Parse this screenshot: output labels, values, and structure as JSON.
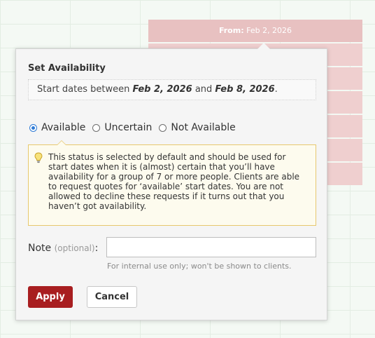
{
  "background": {
    "header_label": "From:",
    "header_date": "Feb 2, 2026"
  },
  "dialog": {
    "title": "Set Availability",
    "range_prefix": "Start dates between ",
    "range_start": "Feb 2, 2026",
    "range_conj": " and ",
    "range_end": "Feb 8, 2026",
    "range_suffix": ".",
    "options": [
      {
        "label": "Available",
        "checked": true
      },
      {
        "label": "Uncertain",
        "checked": false
      },
      {
        "label": "Not Available",
        "checked": false
      }
    ],
    "info_text": "This status is selected by default and should be used for start dates when it is (almost) certain that you’ll have availability for a group of 7 or more people. Clients are able to request quotes for ‘available’ start dates. You are not allowed to decline these requests if it turns out that you haven’t got availability.",
    "note_label": "Note",
    "note_optional": "(optional)",
    "note_colon": ":",
    "note_value": "",
    "note_help": "For internal use only; won't be shown to clients.",
    "apply_label": "Apply",
    "cancel_label": "Cancel"
  },
  "colors": {
    "accent_red": "#a81e20",
    "radio_blue": "#2f7bd6",
    "info_border": "#e7c86e",
    "background_cell": "#efcfcf"
  },
  "icons": {
    "info": "lightbulb-icon"
  }
}
